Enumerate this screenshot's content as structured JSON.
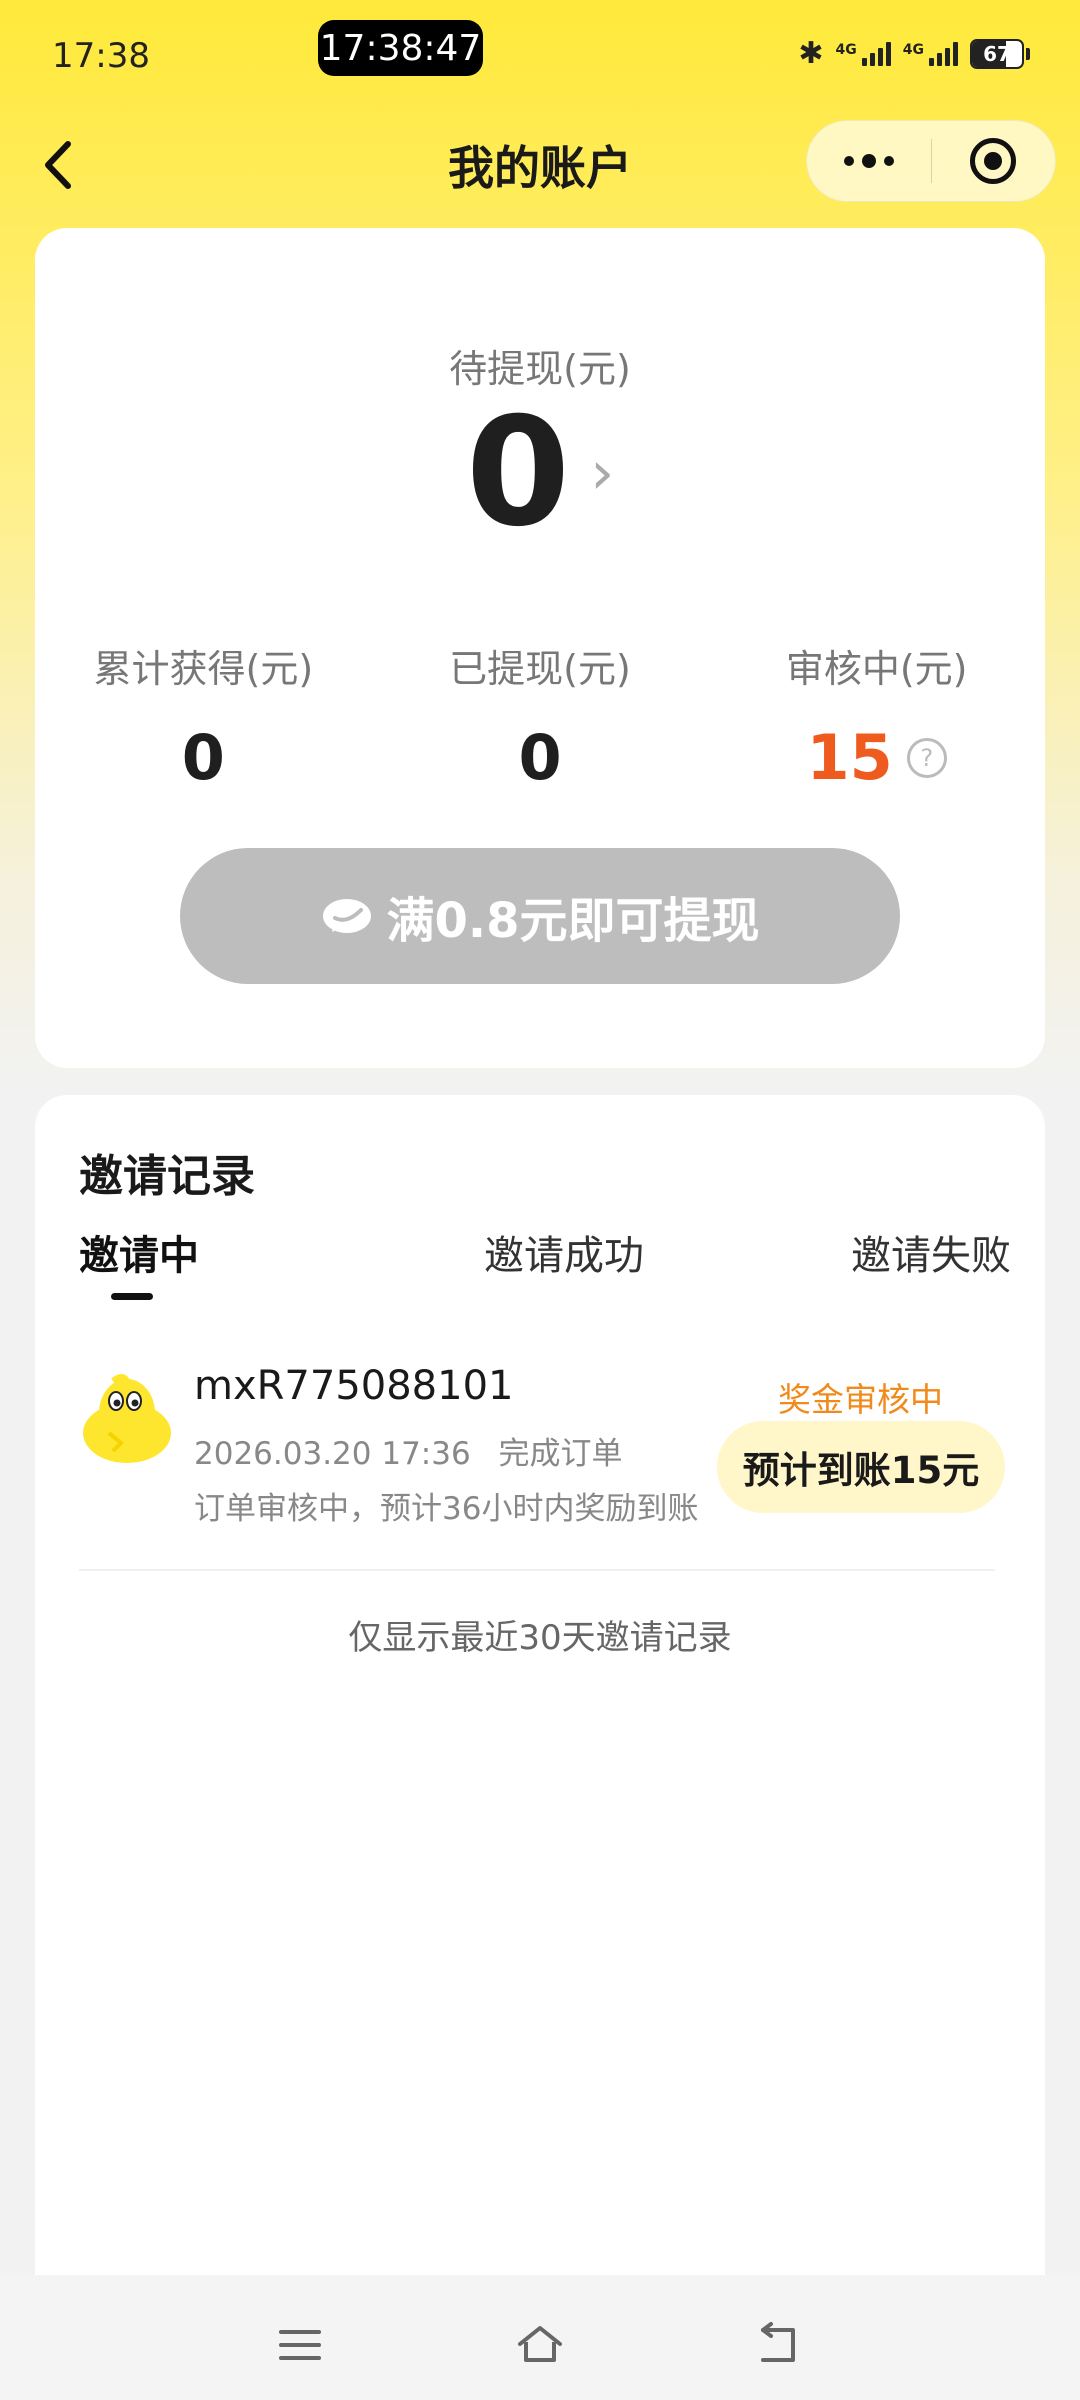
{
  "status_bar": {
    "time": "17:38",
    "clock_pill": "17:38:47",
    "network_1": "4G",
    "network_2": "4G",
    "battery_level": 67,
    "battery_text": "67",
    "bluetooth_icon": "bluetooth-icon"
  },
  "nav": {
    "title": "我的账户",
    "back_icon": "chevron-left-icon",
    "more_icon": "more-dots-icon",
    "close_icon": "target-close-icon"
  },
  "balance": {
    "pending_label": "待提现(元)",
    "pending_value": "0",
    "pending_arrow": "›",
    "stats": [
      {
        "label": "累计获得(元)",
        "value": "0"
      },
      {
        "label": "已提现(元)",
        "value": "0"
      },
      {
        "label": "审核中(元)",
        "value": "15"
      }
    ],
    "help_icon": "?",
    "withdraw_button": "满0.8元即可提现",
    "withdraw_icon": "wechat-icon"
  },
  "invites": {
    "title": "邀请记录",
    "tabs": [
      "邀请中",
      "邀请成功",
      "邀请失败"
    ],
    "active_tab": 0,
    "records": [
      {
        "username": "mxR775088101",
        "datetime": "2026.03.20 17:36",
        "action": "完成订单",
        "note": "订单审核中，预计36小时内奖励到账",
        "status": "奖金审核中",
        "expected": "预计到账15元"
      }
    ],
    "footer_note": "仅显示最近30天邀请记录"
  },
  "system_nav": {
    "menu_icon": "menu-icon",
    "home_icon": "home-icon",
    "back_icon": "back-arrow-icon"
  },
  "colors": {
    "accent_yellow": "#ffe93a",
    "orange_value": "#ef5a1f",
    "status_orange": "#f08a1a",
    "disabled_button": "#bdbdbd",
    "pill_bg": "#fff6c9"
  }
}
